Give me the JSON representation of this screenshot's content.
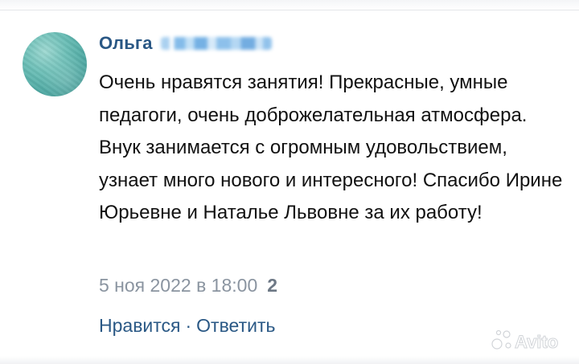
{
  "comment": {
    "author": "Ольга",
    "text": "Очень нравятся занятия! Прекрасные, умные педагоги, очень доброжелательная атмосфера. Внук занимается с огромным удовольствием, узнает много нового и интересного! Спасибо Ирине Юрьевне и Натальe Львовне за их работу!",
    "timestamp": "5 ноя 2022 в 18:00",
    "count": "2",
    "actions": {
      "like": "Нравится",
      "separator": "·",
      "reply": "Ответить"
    }
  },
  "watermark": {
    "text": "Avito"
  },
  "colors": {
    "link": "#2a5885",
    "text": "#111111",
    "meta": "#8a94a0"
  }
}
